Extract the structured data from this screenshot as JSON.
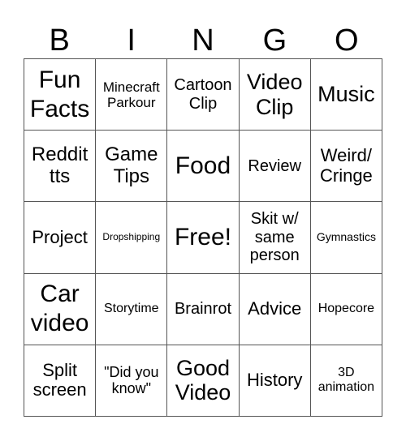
{
  "header": {
    "letters": [
      "B",
      "I",
      "N",
      "G",
      "O"
    ]
  },
  "cells": [
    "Fun Facts",
    "Minecraft Parkour",
    "Cartoon Clip",
    "Video Clip",
    "Music",
    "Reddit tts",
    "Game Tips",
    "Food",
    "Review",
    "Weird/ Cringe",
    "Project",
    "Dropshipping",
    "Free!",
    "Skit w/ same person",
    "Gymnastics",
    "Car video",
    "Storytime",
    "Brainrot",
    "Advice",
    "Hopecore",
    "Split screen",
    "\"Did you know\"",
    "Good Video",
    "History",
    "3D animation"
  ]
}
